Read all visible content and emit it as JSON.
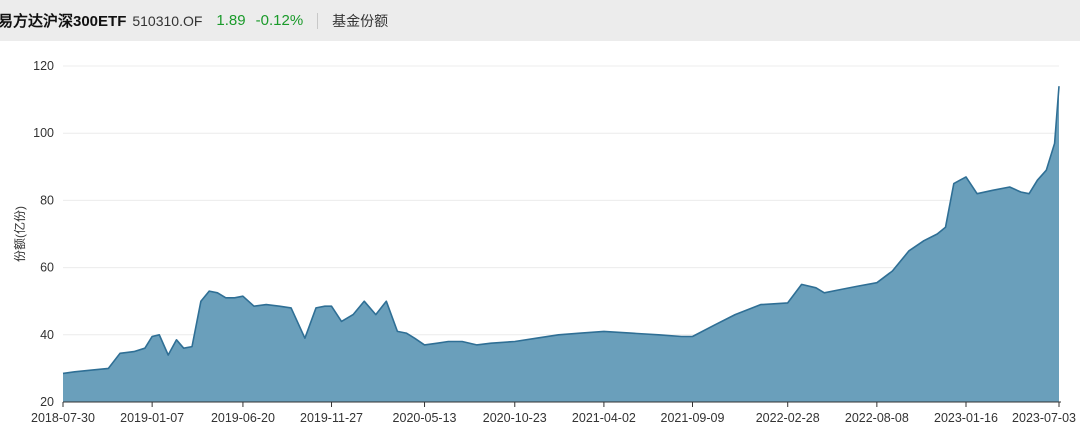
{
  "header": {
    "fund_name": "易方达沪深300ETF",
    "fund_code": "510310.OF",
    "price": "1.89",
    "change": "-0.12%",
    "metric": "基金份额"
  },
  "colors": {
    "change": "#1a9a2a",
    "area_fill": "#6a9fbb",
    "area_line": "#2f6f95"
  },
  "chart_data": {
    "type": "area",
    "title": "",
    "xlabel": "",
    "ylabel": "份额(亿份)",
    "ylim": [
      20,
      120
    ],
    "yticks": [
      20,
      40,
      60,
      80,
      100,
      120
    ],
    "grid": true,
    "x_tick_labels": [
      "2018-07-30",
      "2019-01-07",
      "2019-06-20",
      "2019-11-27",
      "2020-05-13",
      "2020-10-23",
      "2021-04-02",
      "2021-09-09",
      "2022-02-28",
      "2022-08-08",
      "2023-01-16",
      "2023-07-03"
    ],
    "series": [
      {
        "x": [
          "2018-07-30",
          "2018-08-20",
          "2018-09-20",
          "2018-10-20",
          "2018-11-10",
          "2018-12-05",
          "2018-12-25",
          "2019-01-07",
          "2019-01-20",
          "2019-02-05",
          "2019-02-20",
          "2019-03-05",
          "2019-03-20",
          "2019-04-05",
          "2019-04-20",
          "2019-05-05",
          "2019-05-20",
          "2019-06-05",
          "2019-06-20",
          "2019-07-10",
          "2019-08-01",
          "2019-08-25",
          "2019-09-15",
          "2019-10-10",
          "2019-10-30",
          "2019-11-15",
          "2019-11-27",
          "2019-12-15",
          "2020-01-05",
          "2020-01-25",
          "2020-02-15",
          "2020-03-05",
          "2020-03-25",
          "2020-04-10",
          "2020-04-25",
          "2020-05-13",
          "2020-06-05",
          "2020-06-25",
          "2020-07-20",
          "2020-08-15",
          "2020-09-10",
          "2020-10-23",
          "2020-12-01",
          "2021-01-10",
          "2021-02-20",
          "2021-04-02",
          "2021-05-20",
          "2021-07-10",
          "2021-08-20",
          "2021-09-09",
          "2021-10-20",
          "2021-11-25",
          "2022-01-10",
          "2022-02-28",
          "2022-03-25",
          "2022-04-20",
          "2022-05-05",
          "2022-06-05",
          "2022-07-05",
          "2022-08-08",
          "2022-09-05",
          "2022-10-05",
          "2022-11-01",
          "2022-11-25",
          "2022-12-10",
          "2022-12-25",
          "2023-01-05",
          "2023-01-16",
          "2023-02-05",
          "2023-03-05",
          "2023-04-05",
          "2023-04-25",
          "2023-05-10",
          "2023-05-25",
          "2023-06-10",
          "2023-06-25",
          "2023-07-03"
        ],
        "values": [
          28.5,
          29.0,
          29.5,
          30.0,
          34.5,
          35.0,
          36.0,
          39.5,
          40.0,
          34.0,
          38.5,
          36.0,
          36.5,
          50.0,
          53.0,
          52.5,
          51.0,
          51.0,
          51.5,
          48.5,
          49.0,
          48.5,
          48.0,
          39.0,
          48.0,
          48.5,
          48.5,
          44.0,
          46.0,
          50.0,
          46.0,
          50.0,
          41.0,
          40.5,
          39.0,
          37.0,
          37.5,
          38.0,
          38.0,
          37.0,
          37.5,
          38.0,
          39.0,
          40.0,
          40.5,
          41.0,
          40.5,
          40.0,
          39.5,
          39.5,
          43.0,
          46.0,
          49.0,
          49.5,
          55.0,
          54.0,
          52.5,
          53.5,
          54.5,
          55.5,
          59.0,
          65.0,
          68.0,
          70.0,
          72.0,
          85.0,
          86.0,
          87.0,
          82.0,
          83.0,
          84.0,
          82.5,
          82.0,
          86.0,
          89.0,
          97.0,
          114.0
        ]
      }
    ]
  }
}
